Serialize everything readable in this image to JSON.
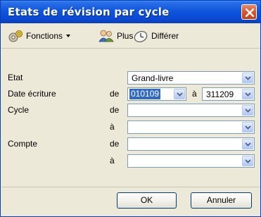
{
  "window": {
    "title": "Etats de révision par cycle",
    "close_icon": "close-icon"
  },
  "toolbar": {
    "fonctions_label": "Fonctions",
    "plus_label": "Plus",
    "differer_label": "Différer"
  },
  "form": {
    "etat": {
      "label": "Etat",
      "value": "Grand-livre"
    },
    "date": {
      "label": "Date écriture",
      "de": "de",
      "from": "010109",
      "a": "à",
      "to": "311209"
    },
    "cycle": {
      "label": "Cycle",
      "de": "de",
      "a": "à",
      "from": "",
      "to": ""
    },
    "compte": {
      "label": "Compte",
      "de": "de",
      "a": "à",
      "from": "",
      "to": ""
    }
  },
  "buttons": {
    "ok": "OK",
    "cancel": "Annuler"
  }
}
